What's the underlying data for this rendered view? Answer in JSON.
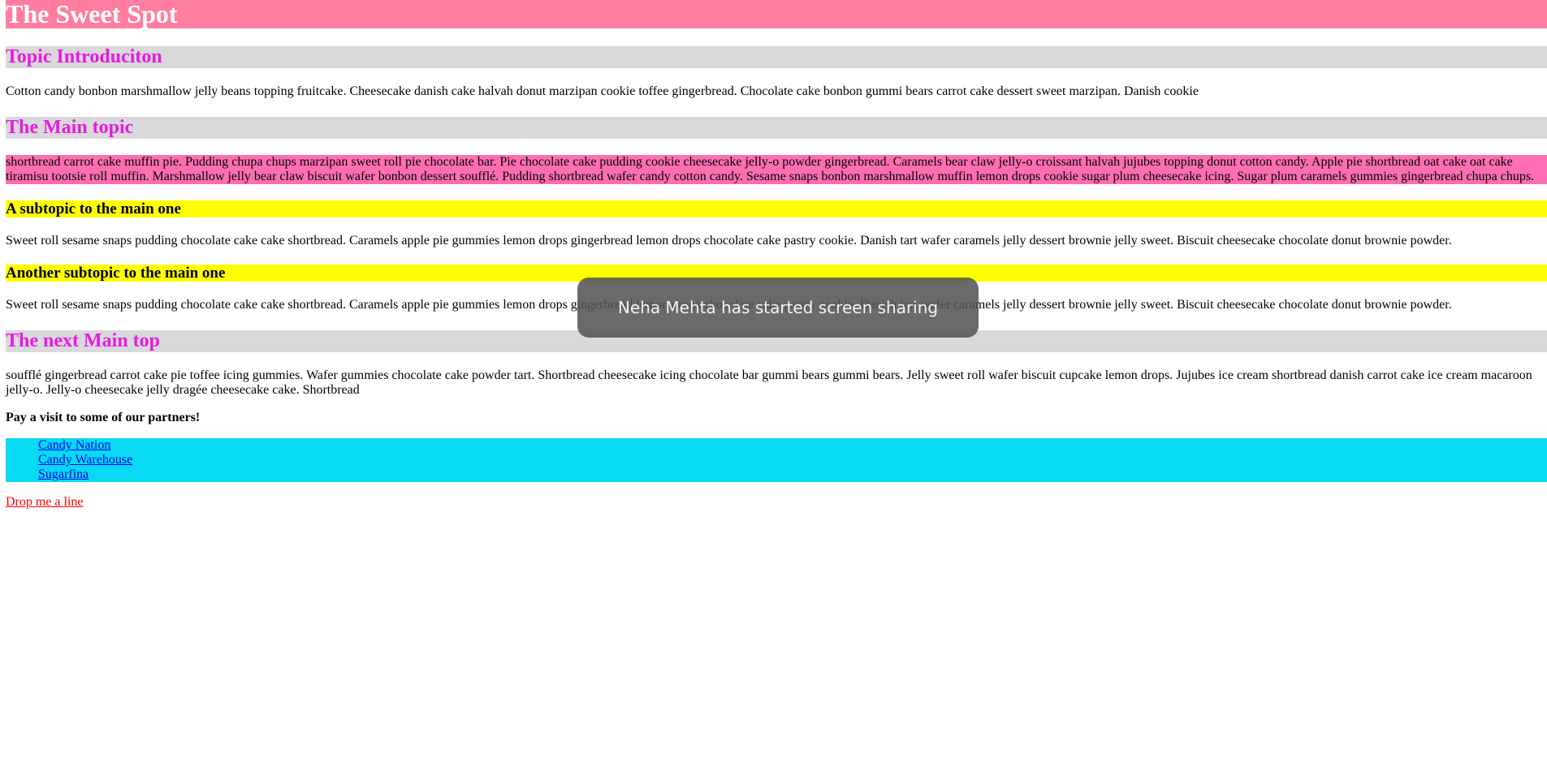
{
  "site": {
    "title": "The Sweet Spot"
  },
  "sections": {
    "intro": {
      "heading": "Topic Introduciton",
      "text": "Cotton candy bonbon marshmallow jelly beans topping fruitcake. Cheesecake danish cake halvah donut marzipan cookie toffee gingerbread. Chocolate cake bonbon gummi bears carrot cake dessert sweet marzipan. Danish cookie"
    },
    "main": {
      "heading": "The Main topic",
      "text": "shortbread carrot cake muffin pie. Pudding chupa chups marzipan sweet roll pie chocolate bar. Pie chocolate cake pudding cookie cheesecake jelly-o powder gingerbread. Caramels bear claw jelly-o croissant halvah jujubes topping donut cotton candy. Apple pie shortbread oat cake oat cake tiramisu tootsie roll muffin. Marshmallow jelly bear claw biscuit wafer bonbon dessert soufflé. Pudding shortbread wafer candy cotton candy. Sesame snaps bonbon marshmallow muffin lemon drops cookie sugar plum cheesecake icing. Sugar plum caramels gummies gingerbread chupa chups.",
      "subtopics": [
        {
          "heading": "A subtopic to the main one",
          "text": "Sweet roll sesame snaps pudding chocolate cake cake shortbread. Caramels apple pie gummies lemon drops gingerbread lemon drops chocolate cake pastry cookie. Danish tart wafer caramels jelly dessert brownie jelly sweet. Biscuit cheesecake chocolate donut brownie powder."
        },
        {
          "heading": "Another subtopic to the main one",
          "text": "Sweet roll sesame snaps pudding chocolate cake cake shortbread. Caramels apple pie gummies lemon drops gingerbread lemon drops chocolate cake pastry cookie. Danish tart wafer caramels jelly dessert brownie jelly sweet. Biscuit cheesecake chocolate donut brownie powder."
        }
      ]
    },
    "next": {
      "heading": "The next Main top",
      "text": "soufflé gingerbread carrot cake pie toffee icing gummies. Wafer gummies chocolate cake powder tart. Shortbread cheesecake icing chocolate bar gummi bears gummi bears. Jelly sweet roll wafer biscuit cupcake lemon drops. Jujubes ice cream shortbread danish carrot cake ice cream macaroon jelly-o. Jelly-o cheesecake jelly dragée cheesecake cake. Shortbread"
    }
  },
  "partners": {
    "label": "Pay a visit to some of our partners!",
    "links": [
      {
        "label": "Candy Nation"
      },
      {
        "label": "Candy Warehouse"
      },
      {
        "label": "Sugarfina"
      }
    ]
  },
  "contact": {
    "label": "Drop me a line"
  },
  "notification": {
    "text": "Neha Mehta has started screen sharing"
  },
  "colors": {
    "title_bar": "#ff7ea0",
    "section_heading_bg": "#d9d8da",
    "section_heading_text": "#e61ae3",
    "main_paragraph_bg": "#ff6eb3",
    "subtopic_bg": "#ffff00",
    "partners_bg": "#07daf2",
    "partner_link": "#0000ee",
    "contact_link": "#ff0000",
    "toast_bg": "#555555"
  }
}
